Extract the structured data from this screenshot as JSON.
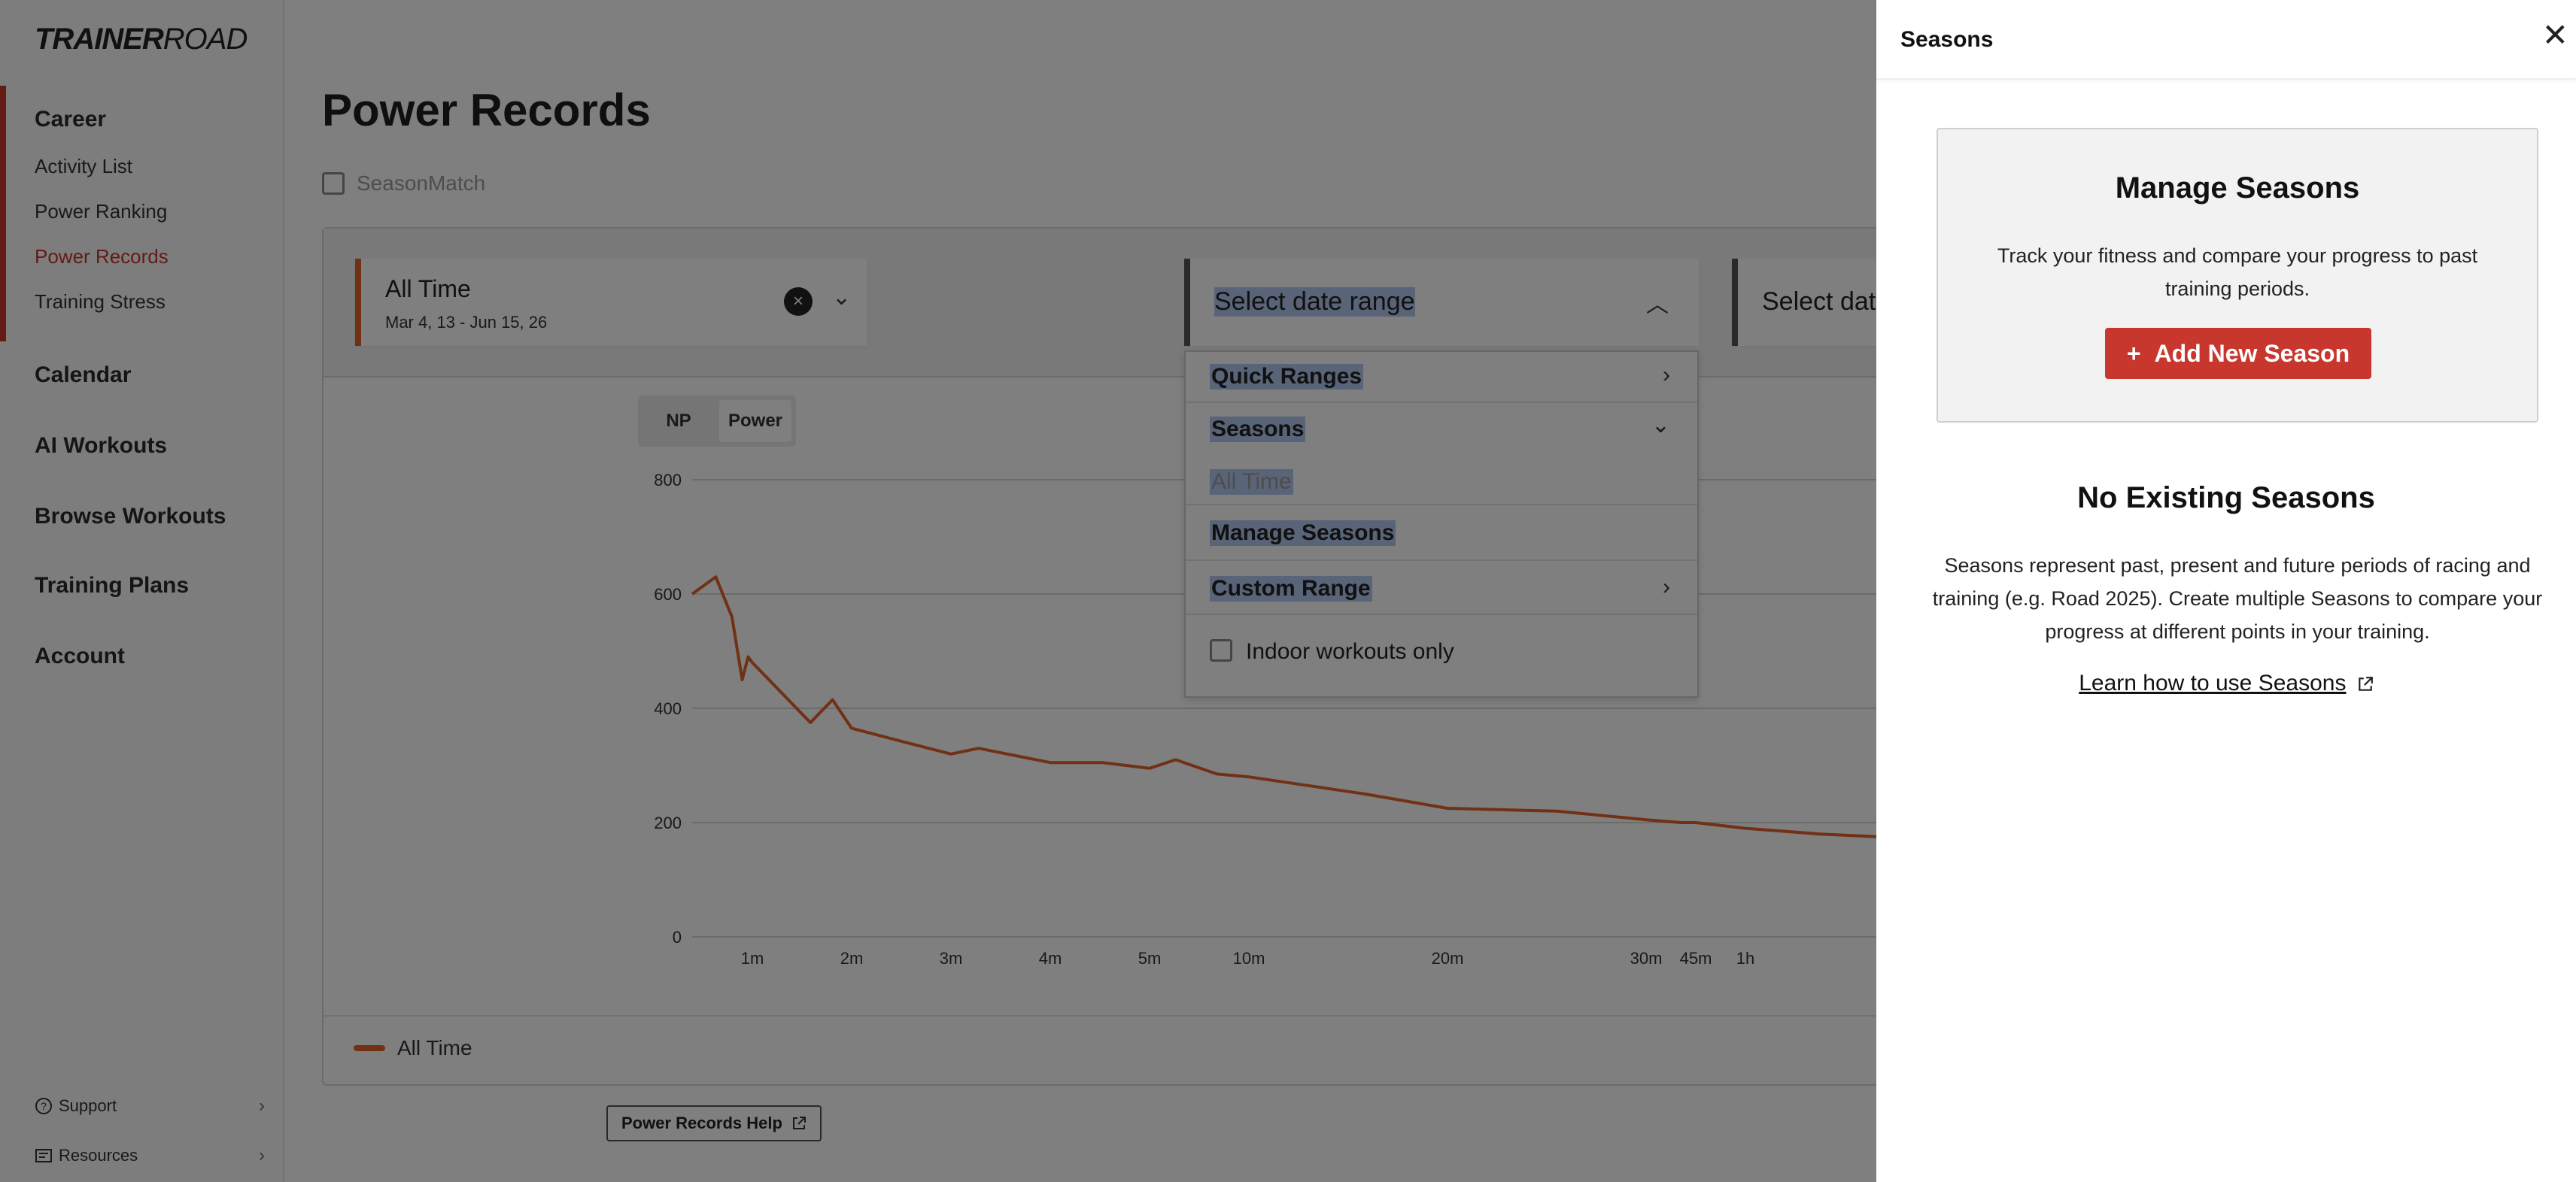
{
  "brand": {
    "logo_bold": "TRAINER",
    "logo_thin": "ROAD"
  },
  "sidebar": {
    "career": "Career",
    "career_items": [
      "Activity List",
      "Power Ranking",
      "Power Records",
      "Training Stress"
    ],
    "sections": [
      "Calendar",
      "AI Workouts",
      "Browse Workouts",
      "Training Plans",
      "Account"
    ],
    "footer": {
      "support": "Support",
      "resources": "Resources"
    }
  },
  "main": {
    "title": "Power Records",
    "seasonmatch": "SeasonMatch",
    "filter1": {
      "title": "All Time",
      "subtitle": "Mar 4, 13 - Jun 15, 26"
    },
    "filter2": {
      "placeholder": "Select date range"
    },
    "filter3": {
      "placeholder": "Select date"
    },
    "toggle": {
      "np": "NP",
      "power": "Power"
    },
    "legend": "All Time",
    "help": "Power Records Help"
  },
  "dropdown": {
    "quick_ranges": "Quick Ranges",
    "seasons": "Seasons",
    "all_time": "All Time",
    "manage_seasons": "Manage Seasons",
    "custom_range": "Custom Range",
    "indoor_only": "Indoor workouts only"
  },
  "drawer": {
    "title": "Seasons",
    "manage_title": "Manage Seasons",
    "manage_desc": "Track your fitness and compare your progress to past training periods.",
    "add_button": "Add New Season",
    "none_title": "No Existing Seasons",
    "none_desc": "Seasons represent past, present and future periods of racing and training (e.g. Road 2025). Create multiple Seasons to compare your progress at different points in your training.",
    "learn_link": "Learn how to use Seasons"
  },
  "colors": {
    "accent": "#c8372d",
    "series": "#e0632a"
  },
  "chart_data": {
    "type": "line",
    "ylim": [
      0,
      800
    ],
    "y_ticks": [
      0,
      200,
      400,
      600,
      800
    ],
    "x_ticks": [
      "1m",
      "2m",
      "3m",
      "4m",
      "5m",
      "10m",
      "20m",
      "30m",
      "45m",
      "1h"
    ],
    "series": [
      {
        "name": "All Time",
        "points": [
          [
            "0:01",
            600
          ],
          [
            "0:05",
            630
          ],
          [
            "0:15",
            560
          ],
          [
            "0:30",
            450
          ],
          [
            "0:45",
            490
          ],
          [
            "1m",
            480
          ],
          [
            "1m30",
            375
          ],
          [
            "1m45",
            415
          ],
          [
            "2m",
            365
          ],
          [
            "2m30",
            340
          ],
          [
            "3m",
            320
          ],
          [
            "3m15",
            330
          ],
          [
            "4m",
            305
          ],
          [
            "4m30",
            305
          ],
          [
            "5m",
            295
          ],
          [
            "6m",
            310
          ],
          [
            "8m",
            285
          ],
          [
            "10m",
            280
          ],
          [
            "15m",
            250
          ],
          [
            "20m",
            225
          ],
          [
            "25m",
            220
          ],
          [
            "30m",
            205
          ],
          [
            "40m",
            200
          ],
          [
            "45m",
            200
          ],
          [
            "1h",
            190
          ],
          [
            "1h15",
            180
          ],
          [
            "1h30",
            175
          ]
        ]
      }
    ]
  }
}
